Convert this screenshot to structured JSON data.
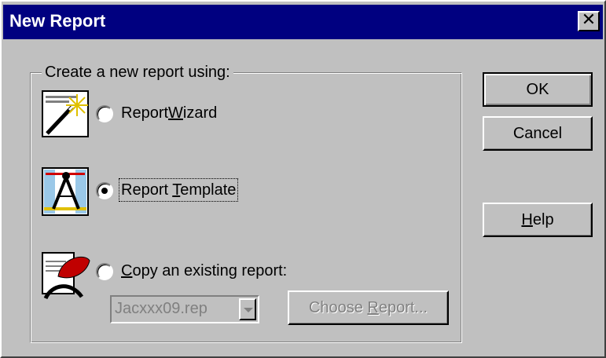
{
  "dialog": {
    "title": "New Report",
    "close_symbol": "✕"
  },
  "group": {
    "legend": "Create a new report using:"
  },
  "options": [
    {
      "id": "wizard",
      "label_pre": "Report",
      "label_ul": "W",
      "label_post": "izard",
      "checked": false,
      "icon": "magic-wand-icon"
    },
    {
      "id": "template",
      "label_pre": "Report ",
      "label_ul": "T",
      "label_post": "emplate",
      "checked": true,
      "icon": "drafting-compass-icon"
    },
    {
      "id": "copy",
      "label_pre": "",
      "label_ul": "C",
      "label_post": "opy an existing report:",
      "checked": false,
      "icon": "copy-report-icon"
    }
  ],
  "report_select": {
    "value": "Jacxxx09.rep"
  },
  "choose_button": {
    "pre": "Choose ",
    "ul": "R",
    "post": "eport..."
  },
  "buttons": {
    "ok": "OK",
    "cancel": "Cancel",
    "help_ul": "H",
    "help_post": "elp"
  },
  "colors": {
    "title_bar": "#000080",
    "face": "#c0c0c0",
    "disabled_text": "#808080"
  }
}
